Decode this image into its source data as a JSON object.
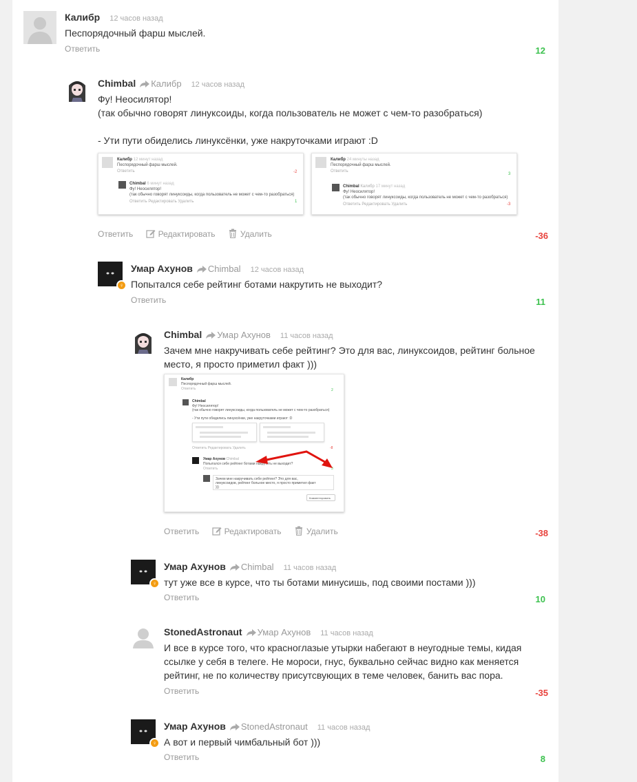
{
  "comments": [
    {
      "author": "Калибр",
      "reply_to": "",
      "time": "12 часов назад",
      "text": "Песпорядочный фарш мыслей.",
      "reply_label": "Ответить",
      "score": "12"
    },
    {
      "author": "Chimbal",
      "reply_to": "Калибр",
      "time": "12 часов назад",
      "text": "Фу! Неосилятор!\n(так обычно говорят линуксоиды, когда пользователь не может с чем-то разобраться)\n\n- Ути пути обиделись линуксёнки, уже накруточками играют :D",
      "reply_label": "Ответить",
      "edit_label": "Редактировать",
      "delete_label": "Удалить",
      "score": "-36"
    },
    {
      "author": "Умар Ахунов",
      "reply_to": "Chimbal",
      "time": "12 часов назад",
      "text": "Попытался себе рейтинг ботами накрутить не выходит?",
      "reply_label": "Ответить",
      "score": "11"
    },
    {
      "author": "Chimbal",
      "reply_to": "Умар Ахунов",
      "time": "11 часов назад",
      "text": "Зачем мне накручивать себе рейтинг? Это для вас, линуксоидов, рейтинг больное место, я просто приметил факт )))",
      "reply_label": "Ответить",
      "edit_label": "Редактировать",
      "delete_label": "Удалить",
      "score": "-38"
    },
    {
      "author": "Умар Ахунов",
      "reply_to": "Chimbal",
      "time": "11 часов назад",
      "text": "тут уже все в курсе, что ты ботами минусишь, под своими постами )))",
      "reply_label": "Ответить",
      "score": "10"
    },
    {
      "author": "StonedAstronaut",
      "reply_to": "Умар Ахунов",
      "time": "11 часов назад",
      "text": "И все в курсе того, что красноглазые утырки набегают в неугодные темы, кидая ссылке у себя в телеге. Не мороси, гнус, буквально сейчас видно как меняется рейтинг, не по количеству присутсвующих в теме человек, банить вас пора.",
      "reply_label": "Ответить",
      "score": "-35"
    },
    {
      "author": "Умар Ахунов",
      "reply_to": "StonedAstronaut",
      "time": "11 часов назад",
      "text": "А вот и первый чимбальный бот )))",
      "reply_label": "Ответить",
      "score": "8"
    }
  ],
  "screenshots": {
    "shot1": {
      "c1_author": "Калибр",
      "c1_time": "12 минут назад",
      "c1_text": "Песпорядочный фарш мыслей.",
      "c1_reply": "Ответить",
      "c1_score": "-2",
      "c2_author": "Chimbal",
      "c2_time": "6 минут назад",
      "c2_text1": "Фу! Неосилятор!",
      "c2_text2": "(так обычно говорят линуксоиды, когда пользователь не может с чем-то разобраться)",
      "c2_actions": "Ответить   Редактировать   Удалить",
      "c2_score": "1"
    },
    "shot2": {
      "c1_author": "Калибр",
      "c1_time": "24 минуты назад",
      "c1_text": "Песпорядочный фарш мыслей.",
      "c1_reply": "Ответить",
      "c1_score": "3",
      "c2_author": "Chimbal",
      "c2_reply_to": "Калибр",
      "c2_time": "17 минут назад",
      "c2_text1": "Фу! Неосилятор!",
      "c2_text2": "(так обычно говорят линуксоиды, когда пользователь не может с чем-то разобраться)",
      "c2_actions": "Ответить   Редактировать   Удалить",
      "c2_score": "-3"
    },
    "shot3": {
      "c1_author": "Калибр",
      "c1_text": "Песпорядочный фарш мыслей.",
      "c1_reply": "Ответить",
      "c1_score": "2",
      "c2_author": "Chimbal",
      "c2_text1": "Фу! Неосилятор!",
      "c2_text2": "(так обычно говорят линуксоиды, когда пользователь не может с чем-то разобраться)",
      "c2_text3": "- Ути пути обиделись линуксёнки, уже накруточками играют :D",
      "c2_actions": "Ответить   Редактировать   Удалить",
      "c2_score": "-8",
      "c3_author": "Умар Ахунов",
      "c3_reply_to": "Chimbal",
      "c3_text": "Попытался себе рейтинг ботами накрутить не выходит?",
      "c3_reply": "Ответить",
      "c3_score": "3",
      "draft_text": "Зачем мне накручивать себе рейтинг? Это для вас, линуксоидов, рейтинг больное место, я просто приметил факт )))",
      "submit_label": "Комментировать"
    }
  },
  "colors": {
    "positive": "#3cc14e",
    "negative": "#e8423c",
    "badge": "#f39c12"
  }
}
